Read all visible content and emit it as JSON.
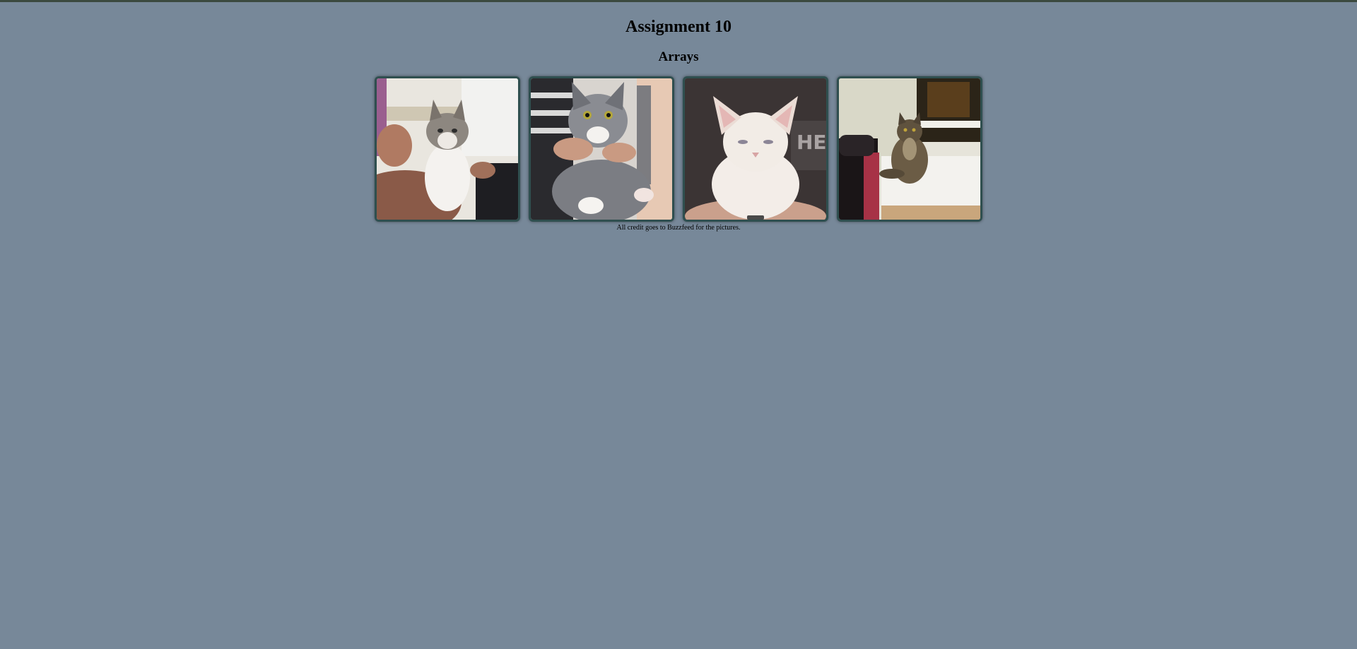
{
  "page": {
    "title": "Assignment 10",
    "subtitle": "Arrays",
    "credit": "All credit goes to Buzzfeed for the pictures."
  },
  "gallery": {
    "images": [
      {
        "alt": "tabby and white kitten held in hands",
        "icon": "kitten-photo-1"
      },
      {
        "alt": "grey and white kitten held up",
        "icon": "kitten-photo-2"
      },
      {
        "alt": "white kitten on lap",
        "icon": "kitten-photo-3"
      },
      {
        "alt": "long-haired tabby cat on windowsill",
        "icon": "kitten-photo-4"
      }
    ]
  },
  "colors": {
    "background": "#778899",
    "frame_border": "#2f4f4f",
    "top_border": "#3b4a3f"
  }
}
